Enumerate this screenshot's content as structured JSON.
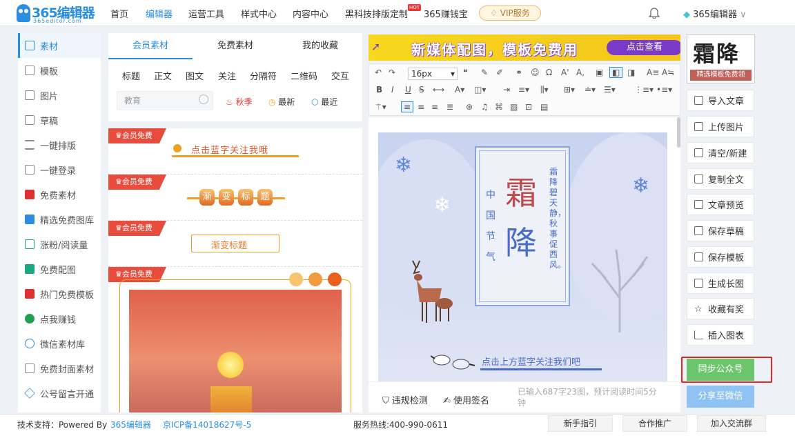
{
  "header": {
    "logo_text": "365编辑器",
    "logo_sub": "365editor.com",
    "nav": [
      "首页",
      "编辑器",
      "运营工具",
      "样式中心",
      "内容中心",
      "黑科技排版定制",
      "365赚钱宝"
    ],
    "hot_badge": "HOT",
    "vip_label": "VIP服务",
    "user_label": "365编辑器"
  },
  "sidebar": {
    "items": [
      {
        "label": "素材",
        "icon": "folder-icon"
      },
      {
        "label": "模板",
        "icon": "template-icon"
      },
      {
        "label": "图片",
        "icon": "image-icon"
      },
      {
        "label": "草稿",
        "icon": "draft-icon"
      },
      {
        "label": "一键排版",
        "icon": "list-icon"
      },
      {
        "label": "一键登录",
        "icon": "login-icon"
      },
      {
        "label": "免费素材",
        "icon": "free-material-icon"
      },
      {
        "label": "精选免费图库",
        "icon": "gallery-icon"
      },
      {
        "label": "涨粉/阅读量",
        "icon": "book-icon"
      },
      {
        "label": "免费配图",
        "icon": "picture-icon"
      },
      {
        "label": "热门免费模板",
        "icon": "hot-template-icon"
      },
      {
        "label": "点我赚钱",
        "icon": "money-icon"
      },
      {
        "label": "微信素材库",
        "icon": "wechat-icon"
      },
      {
        "label": "免费封面素材",
        "icon": "cover-icon"
      },
      {
        "label": "公号留言开通",
        "icon": "layers-icon"
      }
    ]
  },
  "materials": {
    "tabs": [
      "会员素材",
      "免费素材",
      "我的收藏"
    ],
    "categories": [
      "标题",
      "正文",
      "图文",
      "关注",
      "分隔符",
      "二维码",
      "交互"
    ],
    "search_placeholder": "教育",
    "chips": [
      "秋季",
      "最新",
      "最近"
    ],
    "badge": "会员免费",
    "items": [
      "点击蓝字关注我哦",
      "渐变标题",
      "渐变标题"
    ],
    "item2_chars": [
      "渐",
      "变",
      "标",
      "题"
    ]
  },
  "banner": {
    "text": "新媒体配图，模板免费用",
    "button": "点击查看"
  },
  "toolbar": {
    "font_size": "16px"
  },
  "article": {
    "big_chars": [
      "霜",
      "降"
    ],
    "small_chars": [
      "中",
      "国",
      "节",
      "气"
    ],
    "poem": "霜降碧天静，秋事促西风。",
    "follow": "点击上方蓝字关注我们吧"
  },
  "editor_footer": {
    "check": "违规检测",
    "sign": "使用签名",
    "stats": "已输入687字23图，预计阅读时间5分钟"
  },
  "right_panel": {
    "thumb_title": "霜降",
    "thumb_sub": "精选模板免费领",
    "buttons": [
      {
        "label": "导入文章",
        "icon": "import-icon"
      },
      {
        "label": "上传图片",
        "icon": "upload-image-icon"
      },
      {
        "label": "清空/新建",
        "icon": "trash-icon"
      },
      {
        "label": "复制全文",
        "icon": "copy-icon"
      },
      {
        "label": "文章预览",
        "icon": "preview-icon"
      },
      {
        "label": "保存草稿",
        "icon": "save-draft-icon"
      },
      {
        "label": "保存模板",
        "icon": "save-template-icon"
      },
      {
        "label": "生成长图",
        "icon": "long-image-icon"
      },
      {
        "label": "收藏有奖",
        "icon": "star-icon"
      },
      {
        "label": "插入图表",
        "icon": "chart-icon"
      }
    ],
    "sync": "同步公众号",
    "share": "分享至微信"
  },
  "footer": {
    "support": "技术支持：Powered By",
    "support_link": "365编辑器",
    "icp": "京ICP备14018627号-5",
    "hotline": "服务热线:400-990-0611",
    "buttons": [
      "新手指引",
      "合作推广",
      "加入交流群"
    ]
  }
}
